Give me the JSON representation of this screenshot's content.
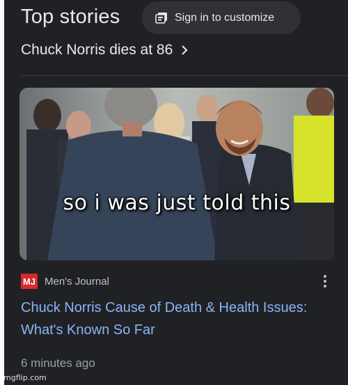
{
  "header": {
    "title": "Top stories",
    "signin_label": "Sign in to customize"
  },
  "story_link": {
    "label": "Chuck Norris dies at 86"
  },
  "article": {
    "image_caption": "so i was just told this",
    "source_logo_text": "MJ",
    "source_name": "Men's Journal",
    "headline": "Chuck Norris Cause of Death & Health Issues: What's Known So Far",
    "time_ago": "6 minutes ago"
  },
  "watermark": "imgflip.com",
  "colors": {
    "background": "#202124",
    "link_blue": "#8ab4f8",
    "text_primary": "#e8eaed",
    "text_secondary": "#9aa0a6",
    "logo_red": "#d8292f"
  },
  "icons": [
    "customize-icon",
    "chevron-right-icon",
    "more-vert-icon"
  ]
}
